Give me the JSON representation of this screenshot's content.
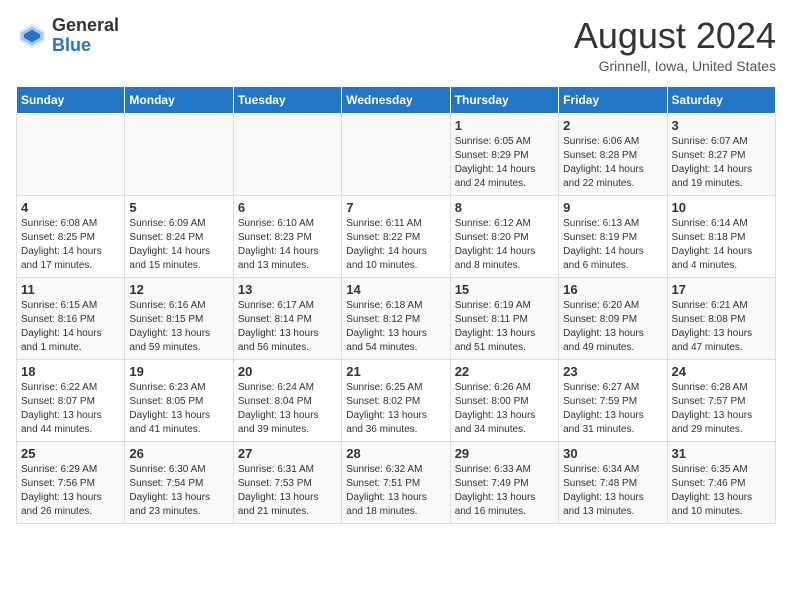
{
  "logo": {
    "general": "General",
    "blue": "Blue"
  },
  "title": "August 2024",
  "location": "Grinnell, Iowa, United States",
  "days_of_week": [
    "Sunday",
    "Monday",
    "Tuesday",
    "Wednesday",
    "Thursday",
    "Friday",
    "Saturday"
  ],
  "weeks": [
    [
      {
        "day": "",
        "info": ""
      },
      {
        "day": "",
        "info": ""
      },
      {
        "day": "",
        "info": ""
      },
      {
        "day": "",
        "info": ""
      },
      {
        "day": "1",
        "info": "Sunrise: 6:05 AM\nSunset: 8:29 PM\nDaylight: 14 hours and 24 minutes."
      },
      {
        "day": "2",
        "info": "Sunrise: 6:06 AM\nSunset: 8:28 PM\nDaylight: 14 hours and 22 minutes."
      },
      {
        "day": "3",
        "info": "Sunrise: 6:07 AM\nSunset: 8:27 PM\nDaylight: 14 hours and 19 minutes."
      }
    ],
    [
      {
        "day": "4",
        "info": "Sunrise: 6:08 AM\nSunset: 8:25 PM\nDaylight: 14 hours and 17 minutes."
      },
      {
        "day": "5",
        "info": "Sunrise: 6:09 AM\nSunset: 8:24 PM\nDaylight: 14 hours and 15 minutes."
      },
      {
        "day": "6",
        "info": "Sunrise: 6:10 AM\nSunset: 8:23 PM\nDaylight: 14 hours and 13 minutes."
      },
      {
        "day": "7",
        "info": "Sunrise: 6:11 AM\nSunset: 8:22 PM\nDaylight: 14 hours and 10 minutes."
      },
      {
        "day": "8",
        "info": "Sunrise: 6:12 AM\nSunset: 8:20 PM\nDaylight: 14 hours and 8 minutes."
      },
      {
        "day": "9",
        "info": "Sunrise: 6:13 AM\nSunset: 8:19 PM\nDaylight: 14 hours and 6 minutes."
      },
      {
        "day": "10",
        "info": "Sunrise: 6:14 AM\nSunset: 8:18 PM\nDaylight: 14 hours and 4 minutes."
      }
    ],
    [
      {
        "day": "11",
        "info": "Sunrise: 6:15 AM\nSunset: 8:16 PM\nDaylight: 14 hours and 1 minute."
      },
      {
        "day": "12",
        "info": "Sunrise: 6:16 AM\nSunset: 8:15 PM\nDaylight: 13 hours and 59 minutes."
      },
      {
        "day": "13",
        "info": "Sunrise: 6:17 AM\nSunset: 8:14 PM\nDaylight: 13 hours and 56 minutes."
      },
      {
        "day": "14",
        "info": "Sunrise: 6:18 AM\nSunset: 8:12 PM\nDaylight: 13 hours and 54 minutes."
      },
      {
        "day": "15",
        "info": "Sunrise: 6:19 AM\nSunset: 8:11 PM\nDaylight: 13 hours and 51 minutes."
      },
      {
        "day": "16",
        "info": "Sunrise: 6:20 AM\nSunset: 8:09 PM\nDaylight: 13 hours and 49 minutes."
      },
      {
        "day": "17",
        "info": "Sunrise: 6:21 AM\nSunset: 8:08 PM\nDaylight: 13 hours and 47 minutes."
      }
    ],
    [
      {
        "day": "18",
        "info": "Sunrise: 6:22 AM\nSunset: 8:07 PM\nDaylight: 13 hours and 44 minutes."
      },
      {
        "day": "19",
        "info": "Sunrise: 6:23 AM\nSunset: 8:05 PM\nDaylight: 13 hours and 41 minutes."
      },
      {
        "day": "20",
        "info": "Sunrise: 6:24 AM\nSunset: 8:04 PM\nDaylight: 13 hours and 39 minutes."
      },
      {
        "day": "21",
        "info": "Sunrise: 6:25 AM\nSunset: 8:02 PM\nDaylight: 13 hours and 36 minutes."
      },
      {
        "day": "22",
        "info": "Sunrise: 6:26 AM\nSunset: 8:00 PM\nDaylight: 13 hours and 34 minutes."
      },
      {
        "day": "23",
        "info": "Sunrise: 6:27 AM\nSunset: 7:59 PM\nDaylight: 13 hours and 31 minutes."
      },
      {
        "day": "24",
        "info": "Sunrise: 6:28 AM\nSunset: 7:57 PM\nDaylight: 13 hours and 29 minutes."
      }
    ],
    [
      {
        "day": "25",
        "info": "Sunrise: 6:29 AM\nSunset: 7:56 PM\nDaylight: 13 hours and 26 minutes."
      },
      {
        "day": "26",
        "info": "Sunrise: 6:30 AM\nSunset: 7:54 PM\nDaylight: 13 hours and 23 minutes."
      },
      {
        "day": "27",
        "info": "Sunrise: 6:31 AM\nSunset: 7:53 PM\nDaylight: 13 hours and 21 minutes."
      },
      {
        "day": "28",
        "info": "Sunrise: 6:32 AM\nSunset: 7:51 PM\nDaylight: 13 hours and 18 minutes."
      },
      {
        "day": "29",
        "info": "Sunrise: 6:33 AM\nSunset: 7:49 PM\nDaylight: 13 hours and 16 minutes."
      },
      {
        "day": "30",
        "info": "Sunrise: 6:34 AM\nSunset: 7:48 PM\nDaylight: 13 hours and 13 minutes."
      },
      {
        "day": "31",
        "info": "Sunrise: 6:35 AM\nSunset: 7:46 PM\nDaylight: 13 hours and 10 minutes."
      }
    ]
  ]
}
